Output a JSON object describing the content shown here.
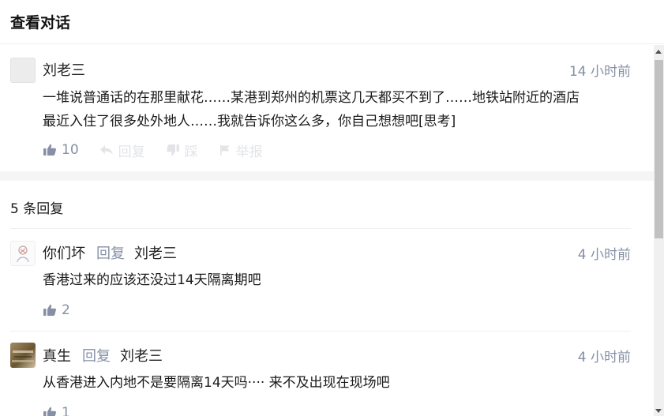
{
  "header": {
    "title": "查看对话"
  },
  "root_comment": {
    "author": "刘老三",
    "time": "14 小时前",
    "lines": [
      "一堆说普通话的在那里献花……某港到郑州的机票这几天都买不到了……地铁站附近的酒店",
      "最近入住了很多处外地人……我就告诉你这么多，你自己想想吧[思考]"
    ],
    "likes": "10",
    "actions": {
      "reply": "回复",
      "dislike": "踩",
      "report": "举报"
    }
  },
  "replies_section": {
    "title": "5 条回复"
  },
  "replies": [
    {
      "author": "你们坏",
      "reply_word": "回复",
      "reply_to": "刘老三",
      "time": "4 小时前",
      "text": "香港过来的应该还没过14天隔离期吧",
      "likes": "2"
    },
    {
      "author": "真生",
      "reply_word": "回复",
      "reply_to": "刘老三",
      "time": "4 小时前",
      "text": "从香港进入内地不是要隔离14天吗···· 来不及出现在现场吧",
      "likes": "1"
    }
  ],
  "colors": {
    "muted": "#8590a6",
    "faded": "#e2e4e8",
    "divider": "#f5f5f5"
  },
  "icons": [
    "thumb-up-icon",
    "reply-arrow-icon",
    "thumb-down-icon",
    "flag-icon"
  ]
}
